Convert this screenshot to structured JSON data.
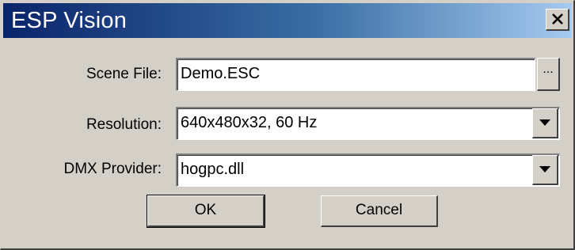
{
  "window": {
    "title": "ESP Vision",
    "close_icon": "close-icon"
  },
  "form": {
    "scene_file": {
      "label": "Scene File:",
      "value": "Demo.ESC",
      "browse_label": "..."
    },
    "resolution": {
      "label": "Resolution:",
      "value": "640x480x32, 60 Hz",
      "dropdown_icon": "chevron-down-icon"
    },
    "dmx_provider": {
      "label": "DMX Provider:",
      "value": "hogpc.dll",
      "dropdown_icon": "chevron-down-icon"
    }
  },
  "buttons": {
    "ok_label": "OK",
    "cancel_label": "Cancel"
  },
  "colors": {
    "titlebar_start": "#0a246a",
    "titlebar_end": "#a6caf0",
    "face": "#d4d0c8"
  }
}
